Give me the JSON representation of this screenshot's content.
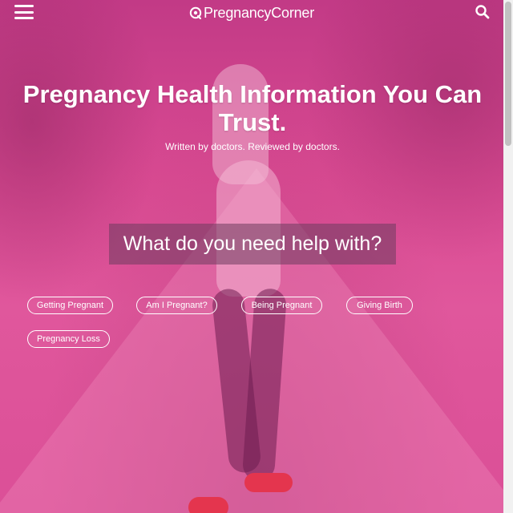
{
  "header": {
    "logo_text": "PregnancyCorner",
    "menu_icon": "hamburger-menu-icon",
    "search_icon": "search-icon"
  },
  "hero": {
    "title": "Pregnancy Health Information You Can Trust.",
    "subtitle": "Written by doctors. Reviewed by doctors.",
    "help_prompt": "What do you need help with?"
  },
  "topics": [
    {
      "label": "Getting Pregnant"
    },
    {
      "label": "Am I Pregnant?"
    },
    {
      "label": "Being Pregnant"
    },
    {
      "label": "Giving Birth"
    },
    {
      "label": "Pregnancy Loss"
    }
  ],
  "colors": {
    "overlay": "#d94a92",
    "text": "#ffffff"
  }
}
